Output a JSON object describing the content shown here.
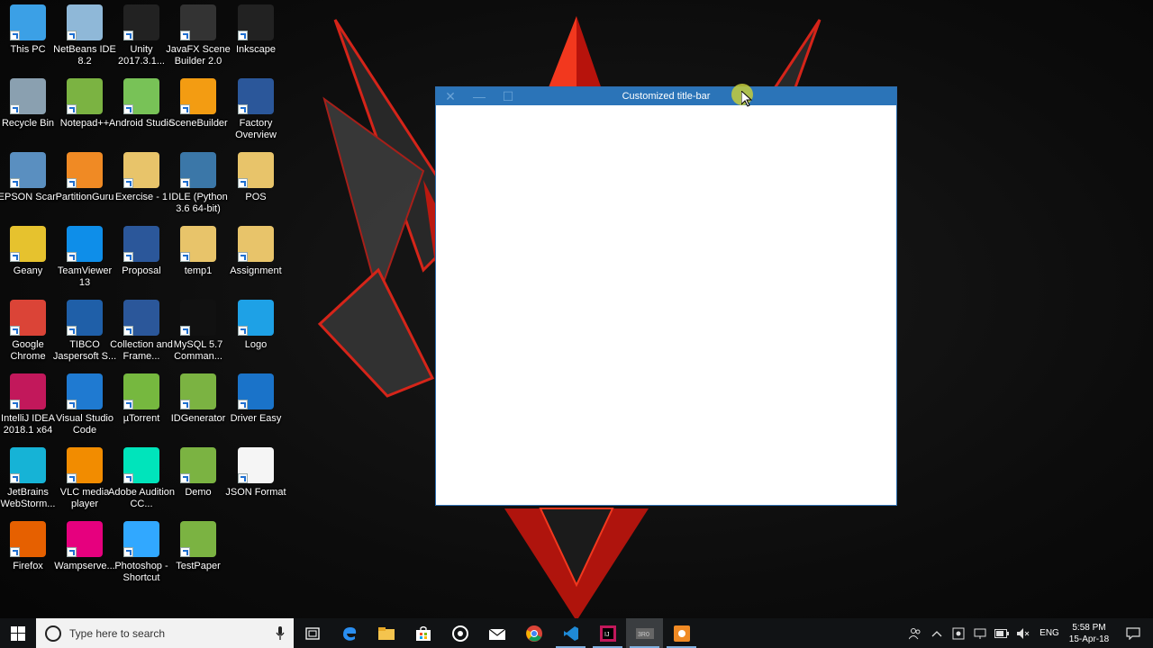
{
  "desktop": {
    "icons": [
      {
        "label": "This PC",
        "icon": "this-pc-icon",
        "color": "#3ba0e6"
      },
      {
        "label": "NetBeans IDE 8.2",
        "icon": "netbeans-icon",
        "color": "#8fb8d8"
      },
      {
        "label": "Unity 2017.3.1...",
        "icon": "unity-icon",
        "color": "#222222"
      },
      {
        "label": "JavaFX Scene Builder 2.0",
        "icon": "javafx-icon",
        "color": "#333333"
      },
      {
        "label": "Inkscape",
        "icon": "inkscape-icon",
        "color": "#222222"
      },
      {
        "label": "Recycle Bin",
        "icon": "recycle-bin-icon",
        "color": "#8aa0b0"
      },
      {
        "label": "Notepad++",
        "icon": "notepadpp-icon",
        "color": "#7bb342"
      },
      {
        "label": "Android Studio",
        "icon": "android-studio-icon",
        "color": "#78c257"
      },
      {
        "label": "SceneBuilder",
        "icon": "scenebuilder-icon",
        "color": "#f39c12"
      },
      {
        "label": "Factory Overview",
        "icon": "word-doc-icon",
        "color": "#2b579a"
      },
      {
        "label": "EPSON Scan",
        "icon": "epson-scan-icon",
        "color": "#5a8fc0"
      },
      {
        "label": "PartitionGuru",
        "icon": "partitionguru-icon",
        "color": "#f08a24"
      },
      {
        "label": "Exercise - 1",
        "icon": "folder-icon",
        "color": "#e8c46a"
      },
      {
        "label": "IDLE (Python 3.6 64-bit)",
        "icon": "python-idle-icon",
        "color": "#3b77a8"
      },
      {
        "label": "POS",
        "icon": "folder-icon",
        "color": "#e8c46a"
      },
      {
        "label": "Geany",
        "icon": "geany-icon",
        "color": "#e6c22e"
      },
      {
        "label": "TeamViewer 13",
        "icon": "teamviewer-icon",
        "color": "#0e8ee9"
      },
      {
        "label": "Proposal",
        "icon": "word-doc-icon",
        "color": "#2b579a"
      },
      {
        "label": "temp1",
        "icon": "folder-icon",
        "color": "#e8c46a"
      },
      {
        "label": "Assignment",
        "icon": "folder-icon",
        "color": "#e8c46a"
      },
      {
        "label": "Google Chrome",
        "icon": "chrome-icon",
        "color": "#db4437"
      },
      {
        "label": "TIBCO Jaspersoft S...",
        "icon": "jaspersoft-icon",
        "color": "#1f5fa8"
      },
      {
        "label": "Collection and Frame...",
        "icon": "word-doc-icon",
        "color": "#2b579a"
      },
      {
        "label": "MySQL 5.7 Comman...",
        "icon": "mysql-icon",
        "color": "#111111"
      },
      {
        "label": "Logo",
        "icon": "internet-explorer-icon",
        "color": "#1ea1e6"
      },
      {
        "label": "IntelliJ IDEA 2018.1 x64",
        "icon": "intellij-icon",
        "color": "#c2185b"
      },
      {
        "label": "Visual Studio Code",
        "icon": "vscode-icon",
        "color": "#1f7ad1"
      },
      {
        "label": "µTorrent",
        "icon": "utorrent-icon",
        "color": "#76b83f"
      },
      {
        "label": "IDGenerator",
        "icon": "java-jar-icon",
        "color": "#7bb342"
      },
      {
        "label": "Driver Easy",
        "icon": "driver-easy-icon",
        "color": "#1a73c9"
      },
      {
        "label": "JetBrains WebStorm...",
        "icon": "webstorm-icon",
        "color": "#16b3d6"
      },
      {
        "label": "VLC media player",
        "icon": "vlc-icon",
        "color": "#f28c00"
      },
      {
        "label": "Adobe Audition CC...",
        "icon": "audition-icon",
        "color": "#00e4bb"
      },
      {
        "label": "Demo",
        "icon": "java-jar-icon",
        "color": "#7bb342"
      },
      {
        "label": "JSON Format",
        "icon": "blank-file-icon",
        "color": "#f5f5f5"
      },
      {
        "label": "Firefox",
        "icon": "firefox-icon",
        "color": "#e66000"
      },
      {
        "label": "Wampserve...",
        "icon": "wampserver-icon",
        "color": "#e6007e"
      },
      {
        "label": "Photoshop - Shortcut",
        "icon": "photoshop-icon",
        "color": "#31a8ff"
      },
      {
        "label": "TestPaper",
        "icon": "java-jar-icon",
        "color": "#7bb342"
      }
    ]
  },
  "window": {
    "title": "Customized title-bar",
    "close_glyph": "✕",
    "minimize_glyph": "—",
    "maximize_glyph": "☐",
    "titlebar_color": "#2b74b8"
  },
  "taskbar": {
    "search_placeholder": "Type here to search",
    "apps": [
      {
        "name": "task-view-icon"
      },
      {
        "name": "edge-icon"
      },
      {
        "name": "file-explorer-icon"
      },
      {
        "name": "store-icon"
      },
      {
        "name": "groove-icon"
      },
      {
        "name": "mail-icon"
      },
      {
        "name": "chrome-icon"
      },
      {
        "name": "vscode-icon"
      },
      {
        "name": "intellij-icon"
      },
      {
        "name": "gif-recorder-icon"
      },
      {
        "name": "scenebuilder-icon"
      }
    ],
    "language": "ENG",
    "time": "5:58 PM",
    "date": "15-Apr-18"
  }
}
